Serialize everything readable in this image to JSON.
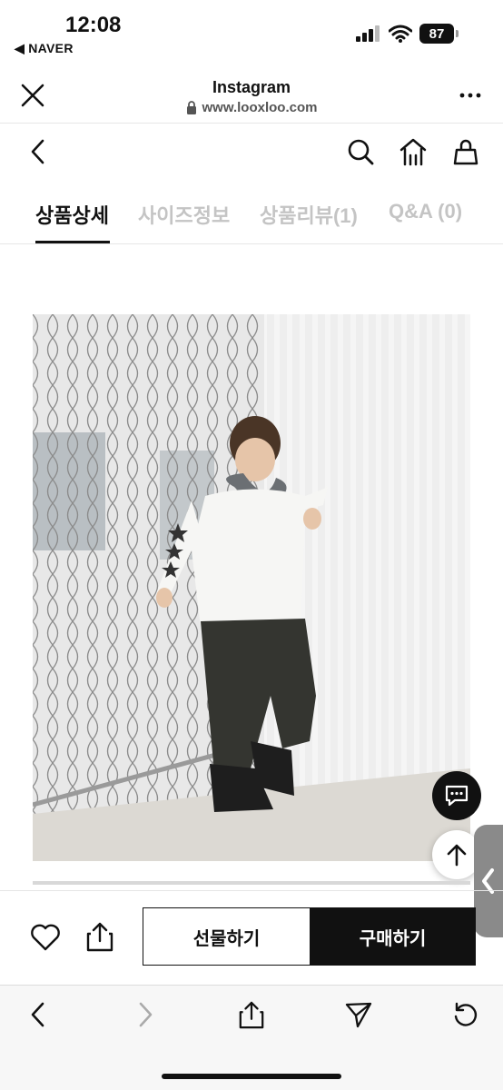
{
  "status": {
    "time": "12:08",
    "back_app": "◀ NAVER",
    "battery": "87"
  },
  "browser": {
    "title": "Instagram",
    "url": "www.looxloo.com"
  },
  "tabs": [
    {
      "label": "상품상세",
      "active": true
    },
    {
      "label": "사이즈정보",
      "active": false
    },
    {
      "label": "상품리뷰(1)",
      "active": false
    },
    {
      "label": "Q&A (0)",
      "active": false
    }
  ],
  "actions": {
    "gift_label": "선물하기",
    "buy_label": "구매하기"
  },
  "icons": {
    "close": "close-icon",
    "more": "more-icon",
    "lock": "lock-icon",
    "back": "chevron-left-icon",
    "search": "search-icon",
    "home": "home-icon",
    "bag": "shopping-bag-icon",
    "heart": "heart-icon",
    "share": "share-icon",
    "chat": "chat-icon",
    "up": "arrow-up-icon",
    "nav_back": "chevron-left-icon",
    "nav_forward": "chevron-right-icon",
    "send": "send-icon",
    "reload": "reload-icon"
  },
  "colors": {
    "primary": "#111111",
    "inactive_tab": "#c4c4c4",
    "muted": "#555555"
  }
}
